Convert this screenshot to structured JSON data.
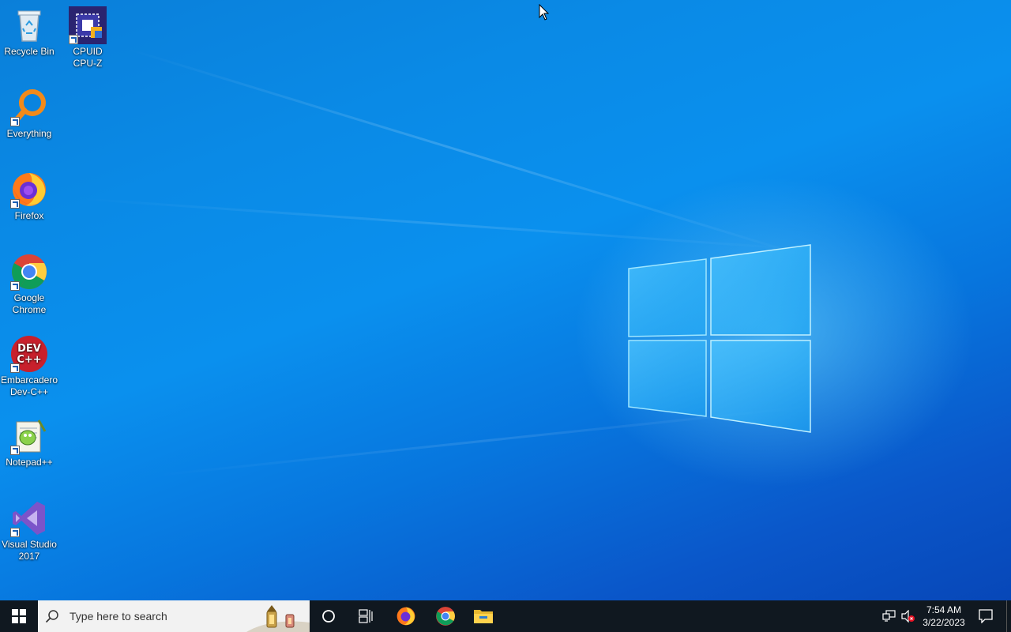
{
  "desktop": {
    "icons": [
      {
        "id": "recycle-bin",
        "label": "Recycle Bin",
        "icon": "recycle-bin-icon"
      },
      {
        "id": "cpuz",
        "label": "CPUID\nCPU-Z",
        "icon": "cpuz-icon"
      },
      {
        "id": "everything",
        "label": "Everything",
        "icon": "everything-search-icon"
      },
      {
        "id": "firefox",
        "label": "Firefox",
        "icon": "firefox-icon"
      },
      {
        "id": "chrome",
        "label": "Google\nChrome",
        "icon": "chrome-icon"
      },
      {
        "id": "devcpp",
        "label": "Embarcadero\nDev-C++",
        "icon": "devcpp-icon",
        "glyph_text": "DEV\nC++"
      },
      {
        "id": "notepadpp",
        "label": "Notepad++",
        "icon": "notepadpp-icon"
      },
      {
        "id": "vs2017",
        "label": "Visual Studio\n2017",
        "icon": "visual-studio-icon"
      }
    ]
  },
  "taskbar": {
    "search_placeholder": "Type here to search",
    "pinned": [
      "firefox-icon",
      "chrome-icon",
      "file-explorer-icon"
    ],
    "clock": {
      "time": "7:54 AM",
      "date": "3/22/2023"
    },
    "tray": [
      "network-icon",
      "volume-muted-icon",
      "notification-icon"
    ]
  },
  "colors": {
    "taskbar_bg": "#101820",
    "desktop_blue": "#0a8ae6",
    "search_bg": "#f2f2f2"
  }
}
